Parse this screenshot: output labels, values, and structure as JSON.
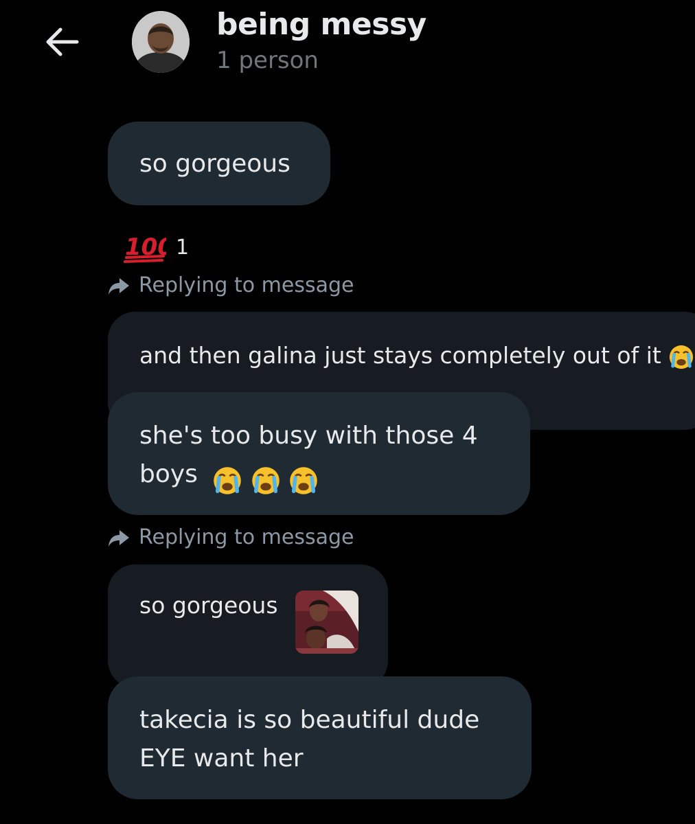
{
  "header": {
    "back_icon": "arrow-left-icon",
    "title": "being messy",
    "subtitle": "1 person"
  },
  "messages": [
    {
      "text": "so gorgeous"
    },
    {
      "reaction_emoji": "hundred-points-emoji",
      "reaction_count": "1"
    },
    {
      "reply_label": "Replying to message"
    },
    {
      "quoted_text": "and then galina just stays completely out of it",
      "quoted_emoji": "loudly-crying-emoji"
    },
    {
      "text": "she's too busy with those 4\nboys",
      "emojis": [
        "loudly-crying-emoji",
        "loudly-crying-emoji",
        "loudly-crying-emoji"
      ]
    },
    {
      "reply_label": "Replying to message"
    },
    {
      "quoted_text": "so gorgeous",
      "quoted_attachment": "photo-thumbnail"
    },
    {
      "text": "takecia is so beautiful dude\nEYE want her"
    }
  ],
  "colors": {
    "background": "#000000",
    "bubble": "#202a33",
    "quoted_bubble": "#161c22",
    "primary_text": "#e7e9ea",
    "secondary_text": "#71767b"
  }
}
